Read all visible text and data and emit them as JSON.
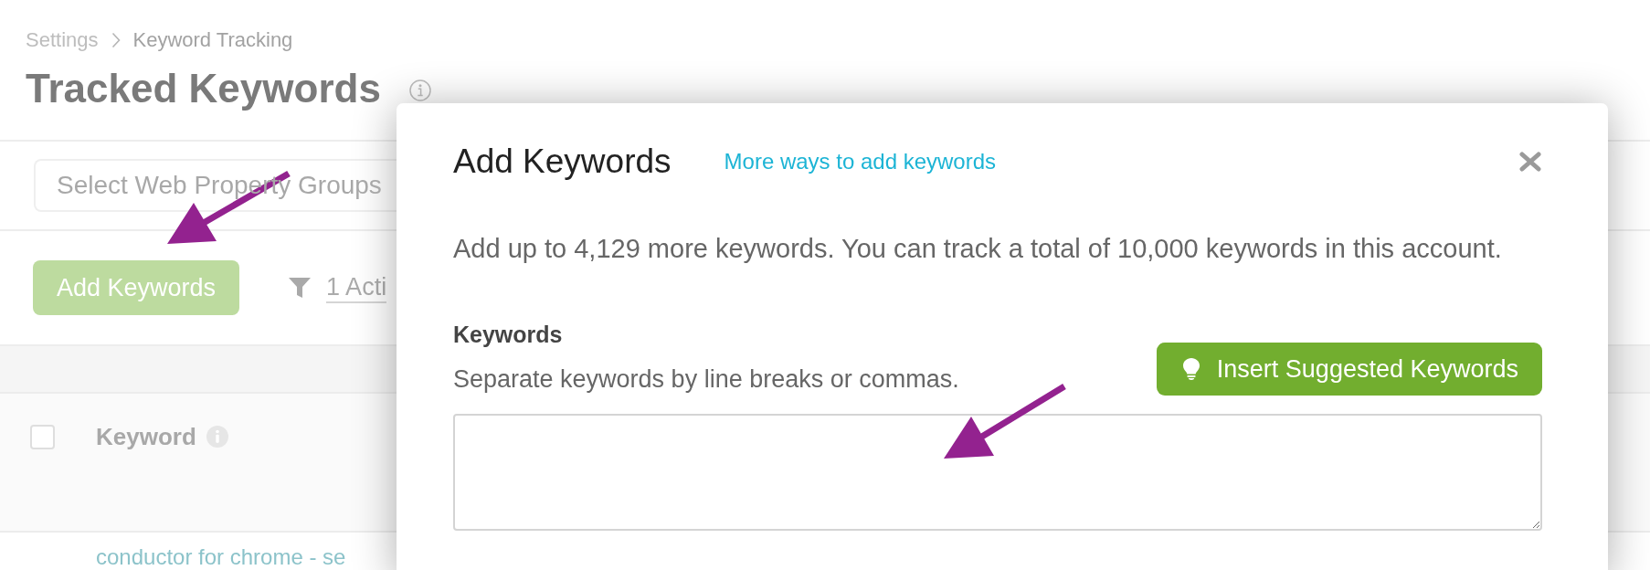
{
  "breadcrumb": [
    {
      "label": "Settings",
      "kind": "link"
    },
    {
      "label": "Keyword Tracking",
      "kind": "current"
    }
  ],
  "page_title": "Tracked Keywords",
  "filters": {
    "web_property_groups": {
      "placeholder": "Select Web Property Groups"
    }
  },
  "toolbar": {
    "add_button": "Add Keywords",
    "active_filters": "1 Acti"
  },
  "table": {
    "header_checkbox": {
      "checked": false
    },
    "columns": [
      "Keyword"
    ],
    "rows": [
      {
        "keyword": "conductor for chrome - se"
      }
    ]
  },
  "dialog": {
    "title": "Add Keywords",
    "link": "More ways to add keywords",
    "description": "Add up to 4,129 more keywords. You can track a total of 10,000 keywords in this account.",
    "field": {
      "label": "Keywords",
      "hint": "Separate keywords by line breaks or commas."
    },
    "suggest_button": "Insert Suggested Keywords"
  }
}
